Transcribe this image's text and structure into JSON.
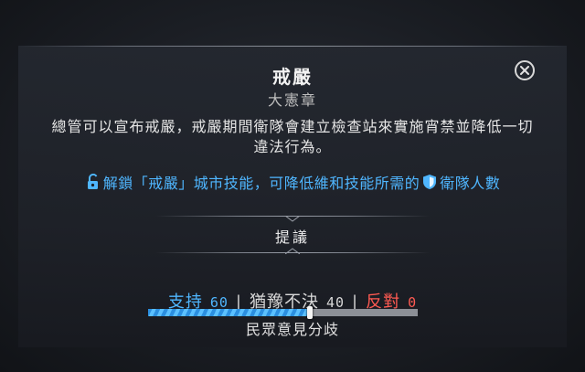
{
  "dialog": {
    "title": "戒嚴",
    "subtitle": "大憲章",
    "description": "總管可以宣布戒嚴，戒嚴期間衛隊會建立檢查站來實施宵禁並降低一切違法行為。",
    "unlock": {
      "prefix": "解鎖「戒嚴」城市技能，可降低維和技能所需的",
      "suffix": "衛隊人數",
      "lock_icon": "unlock-icon",
      "shield_icon": "shield-icon"
    },
    "close_icon": "close-icon",
    "proposal_label": "提議"
  },
  "opinion": {
    "support_label": "支持",
    "support_value": "60",
    "neutral_label": "猶豫不決",
    "neutral_value": "40",
    "oppose_label": "反對",
    "oppose_value": "0",
    "caption": "民眾意見分歧",
    "support_fraction": 0.6,
    "neutral_fraction": 0.4,
    "oppose_fraction": 0.0
  },
  "colors": {
    "support": "#4fb6ff",
    "oppose": "#ff5a52",
    "neutral": "#d8d8d8"
  }
}
